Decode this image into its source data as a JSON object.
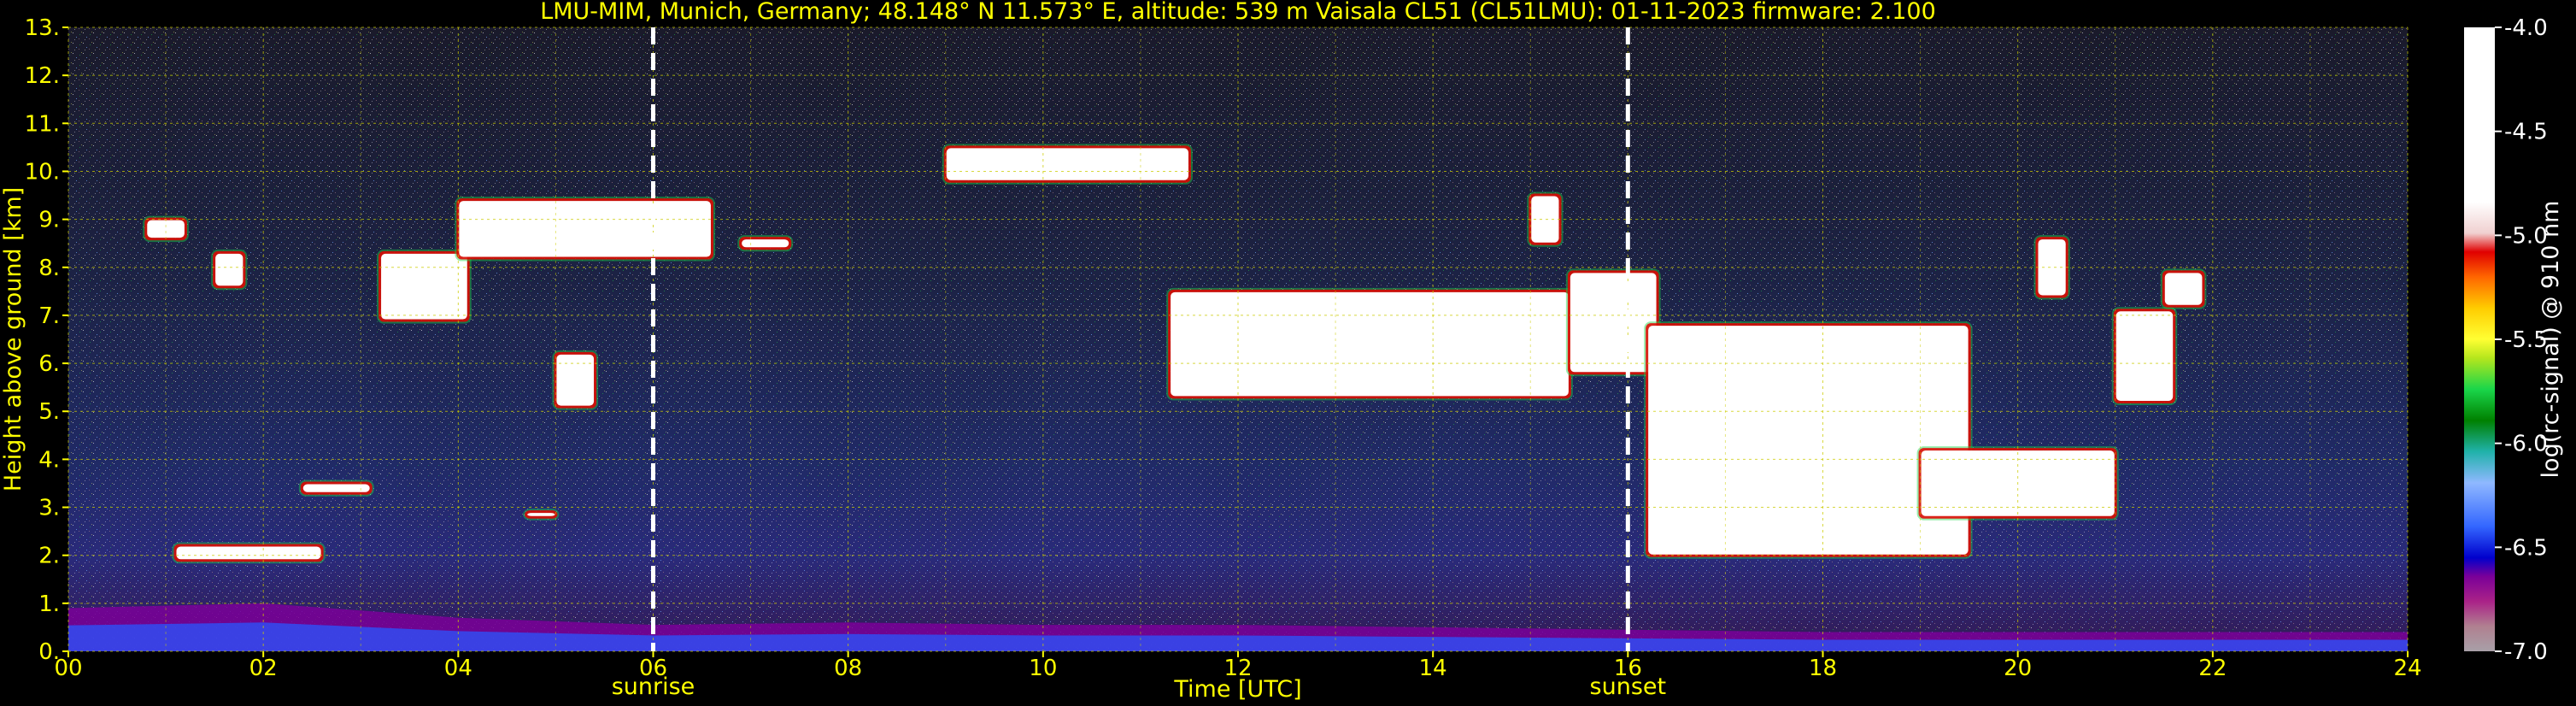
{
  "chart_data": {
    "type": "heatmap",
    "title": "LMU-MIM, Munich, Germany; 48.148° N 11.573° E, altitude: 539 m    Vaisala CL51 (CL51LMU): 01-11-2023    firmware: 2.100",
    "xlabel": "Time [UTC]",
    "ylabel": "Height above ground [km]",
    "xlim": [
      0,
      24
    ],
    "ylim": [
      0,
      13
    ],
    "x_ticks": [
      "00",
      "02",
      "04",
      "06",
      "08",
      "10",
      "12",
      "14",
      "16",
      "18",
      "20",
      "22",
      "24"
    ],
    "x_tick_values": [
      0,
      2,
      4,
      6,
      8,
      10,
      12,
      14,
      16,
      18,
      20,
      22,
      24
    ],
    "y_ticks": [
      "0.",
      "1.",
      "2.",
      "3.",
      "4.",
      "5.",
      "6.",
      "7.",
      "8.",
      "9.",
      "10.",
      "11.",
      "12.",
      "13."
    ],
    "y_tick_values": [
      0,
      1,
      2,
      3,
      4,
      5,
      6,
      7,
      8,
      9,
      10,
      11,
      12,
      13
    ],
    "grid": true,
    "markers": [
      {
        "label": "sunrise",
        "x": 6.0
      },
      {
        "label": "sunset",
        "x": 16.0
      }
    ],
    "colorbar": {
      "label": "log(rc-signal) @ 910 nm",
      "ticks": [
        "-4.0",
        "-4.5",
        "-5.0",
        "-5.5",
        "-6.0",
        "-6.5",
        "-7.0"
      ],
      "tick_values": [
        -4.0,
        -4.5,
        -5.0,
        -5.5,
        -6.0,
        -6.5,
        -7.0
      ],
      "range": [
        -7.0,
        -4.0
      ]
    },
    "boundary_layer": [
      {
        "x": 0.0,
        "y": 0.9
      },
      {
        "x": 1.0,
        "y": 0.95
      },
      {
        "x": 2.0,
        "y": 1.0
      },
      {
        "x": 3.0,
        "y": 0.85
      },
      {
        "x": 4.0,
        "y": 0.7
      },
      {
        "x": 6.0,
        "y": 0.55
      },
      {
        "x": 8.0,
        "y": 0.6
      },
      {
        "x": 10.0,
        "y": 0.55
      },
      {
        "x": 12.0,
        "y": 0.55
      },
      {
        "x": 14.0,
        "y": 0.5
      },
      {
        "x": 16.0,
        "y": 0.45
      },
      {
        "x": 18.0,
        "y": 0.4
      },
      {
        "x": 20.0,
        "y": 0.4
      },
      {
        "x": 22.0,
        "y": 0.4
      },
      {
        "x": 24.0,
        "y": 0.4
      }
    ],
    "cloud_layers": [
      {
        "x_start": 0.8,
        "x_end": 1.2,
        "y_low": 8.6,
        "y_high": 9.0
      },
      {
        "x_start": 1.5,
        "x_end": 1.8,
        "y_low": 7.6,
        "y_high": 8.3
      },
      {
        "x_start": 1.1,
        "x_end": 2.6,
        "y_low": 1.9,
        "y_high": 2.2
      },
      {
        "x_start": 2.4,
        "x_end": 3.1,
        "y_low": 3.3,
        "y_high": 3.5
      },
      {
        "x_start": 3.2,
        "x_end": 4.1,
        "y_low": 6.9,
        "y_high": 8.3
      },
      {
        "x_start": 4.0,
        "x_end": 6.6,
        "y_low": 8.2,
        "y_high": 9.4
      },
      {
        "x_start": 5.0,
        "x_end": 5.4,
        "y_low": 5.1,
        "y_high": 6.2
      },
      {
        "x_start": 4.7,
        "x_end": 5.0,
        "y_low": 2.8,
        "y_high": 2.9
      },
      {
        "x_start": 6.9,
        "x_end": 7.4,
        "y_low": 8.4,
        "y_high": 8.6
      },
      {
        "x_start": 9.0,
        "x_end": 11.5,
        "y_low": 9.8,
        "y_high": 10.5
      },
      {
        "x_start": 11.3,
        "x_end": 15.4,
        "y_low": 5.3,
        "y_high": 7.5
      },
      {
        "x_start": 15.0,
        "x_end": 15.3,
        "y_low": 8.5,
        "y_high": 9.5
      },
      {
        "x_start": 15.4,
        "x_end": 16.3,
        "y_low": 5.8,
        "y_high": 7.9
      },
      {
        "x_start": 16.2,
        "x_end": 19.5,
        "y_low": 2.0,
        "y_high": 6.8
      },
      {
        "x_start": 19.0,
        "x_end": 21.0,
        "y_low": 2.8,
        "y_high": 4.2
      },
      {
        "x_start": 20.2,
        "x_end": 20.5,
        "y_low": 7.4,
        "y_high": 8.6
      },
      {
        "x_start": 21.0,
        "x_end": 21.6,
        "y_low": 5.2,
        "y_high": 7.1
      },
      {
        "x_start": 21.5,
        "x_end": 21.9,
        "y_low": 7.2,
        "y_high": 7.9
      }
    ],
    "colormap": [
      "#ffffff",
      "#f2d8d8",
      "#e60000",
      "#ff6600",
      "#ffb300",
      "#ffff00",
      "#b5e61d",
      "#1ad64a",
      "#008000",
      "#20b2aa",
      "#8fb8ff",
      "#3366ff",
      "#0000cc",
      "#7a0099",
      "#aa2288",
      "#b08090",
      "#a8a0a8"
    ]
  }
}
